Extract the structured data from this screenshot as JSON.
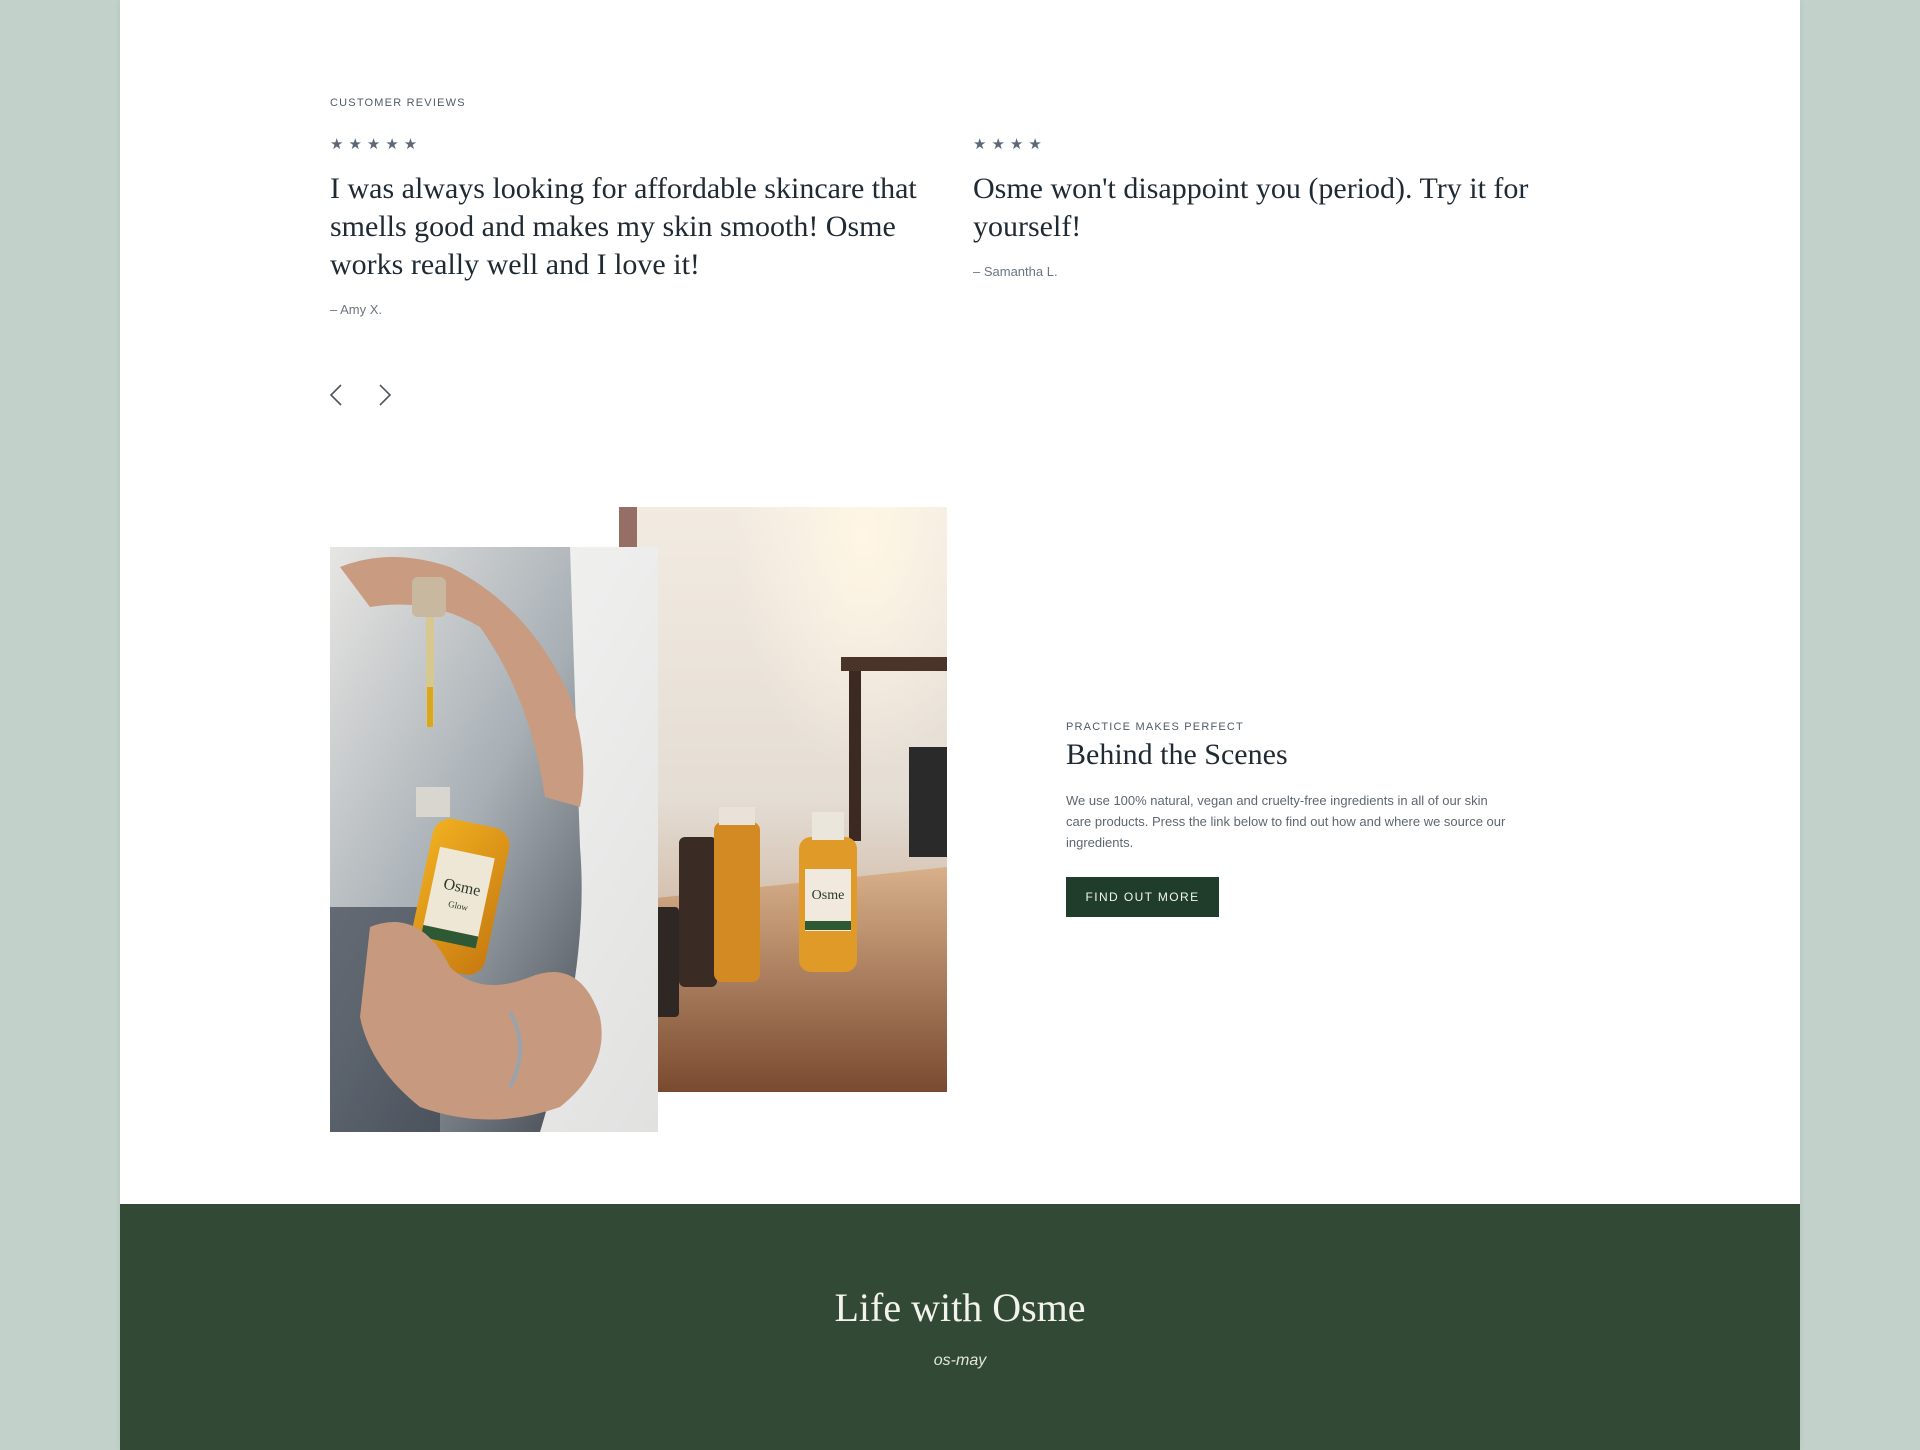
{
  "reviews": {
    "eyebrow": "CUSTOMER REVIEWS",
    "items": [
      {
        "rating": 5,
        "stars": "★★★★★",
        "quote": "I was always looking for affordable skincare that smells good and makes my skin smooth! Osme works really well and I love it!",
        "author": "– Amy X."
      },
      {
        "rating": 4,
        "stars": "★★★★",
        "quote": "Osme won't disappoint you (period). Try it for yourself!",
        "author": "– Samantha L."
      }
    ],
    "prev_icon": "chevron-left-icon",
    "next_icon": "chevron-right-icon"
  },
  "behind_scenes": {
    "eyebrow": "PRACTICE MAKES PERFECT",
    "title": "Behind the Scenes",
    "body": "We use 100% natural, vegan and cruelty-free ingredients in all of our skin care products. Press the link below to find out how and where we source our ingredients.",
    "button_label": "FIND OUT MORE",
    "photo_bottle_label": "Osme",
    "photo_bottle_sublabel": "Glow"
  },
  "band": {
    "title": "Life with Osme",
    "subtitle": "os-may"
  },
  "colors": {
    "outer_background": "#c2d2cb",
    "page_background": "#ffffff",
    "button": "#1f3d2a",
    "band": "#324a35",
    "star": "#5d6876"
  }
}
